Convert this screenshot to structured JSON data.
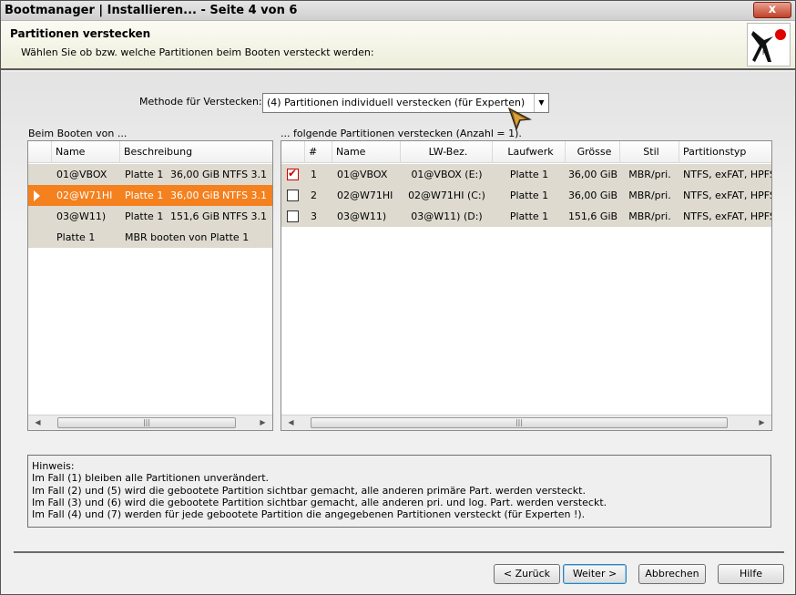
{
  "window": {
    "title": "Bootmanager | Installieren...  - Seite 4 von 6",
    "close_label": "x"
  },
  "header": {
    "title": "Partitionen verstecken",
    "subtitle": "Wählen Sie ob bzw. welche Partitionen beim Booten versteckt werden:"
  },
  "method": {
    "label": "Methode für Verstecken:",
    "selected": "(4) Partitionen individuell verstecken (für Experten)"
  },
  "left": {
    "label": "Beim Booten von ...",
    "columns": [
      "Name",
      "Beschreibung"
    ],
    "rows": [
      {
        "name": "01@VBOX",
        "desc": "Platte 1",
        "size": "36,00 GiB",
        "fs": "NTFS 3.1",
        "selected": false
      },
      {
        "name": "02@W71HI",
        "desc": "Platte 1",
        "size": "36,00 GiB",
        "fs": "NTFS 3.1",
        "selected": true
      },
      {
        "name": "03@W11)",
        "desc": "Platte 1",
        "size": "151,6 GiB",
        "fs": "NTFS 3.1",
        "selected": false
      },
      {
        "name": "Platte 1",
        "desc": "MBR booten von Platte 1",
        "size": "",
        "fs": "",
        "selected": false
      }
    ]
  },
  "right": {
    "label": "... folgende Partitionen verstecken (Anzahl = 1).",
    "columns": [
      "#",
      "Name",
      "LW-Bez.",
      "Laufwerk",
      "Grösse",
      "Stil",
      "Partitionstyp"
    ],
    "rows": [
      {
        "checked": true,
        "num": "1",
        "name": "01@VBOX",
        "lw": "01@VBOX (E:)",
        "drive": "Platte 1",
        "size": "36,00 GiB",
        "style": "MBR/pri.",
        "type": "NTFS, exFAT, HPFS"
      },
      {
        "checked": false,
        "num": "2",
        "name": "02@W71HI",
        "lw": "02@W71HI (C:)",
        "drive": "Platte 1",
        "size": "36,00 GiB",
        "style": "MBR/pri.",
        "type": "NTFS, exFAT, HPFS"
      },
      {
        "checked": false,
        "num": "3",
        "name": "03@W11)",
        "lw": "03@W11) (D:)",
        "drive": "Platte 1",
        "size": "151,6 GiB",
        "style": "MBR/pri.",
        "type": "NTFS, exFAT, HPFS"
      }
    ]
  },
  "hint": {
    "lines": [
      "Hinweis:",
      "Im Fall (1) bleiben alle Partitionen unverändert.",
      "Im Fall (2) und (5) wird die gebootete Partition sichtbar gemacht, alle anderen primäre Part. werden versteckt.",
      "Im Fall (3) und (6) wird die gebootete Partition sichtbar gemacht, alle anderen pri. und log. Part. werden versteckt.",
      "Im Fall (4) und (7) werden für jede gebootete Partition die angegebenen Partitionen versteckt (für Experten !)."
    ]
  },
  "buttons": {
    "back": "< Zurück",
    "next": "Weiter >",
    "cancel": "Abbrechen",
    "help": "Hilfe"
  }
}
